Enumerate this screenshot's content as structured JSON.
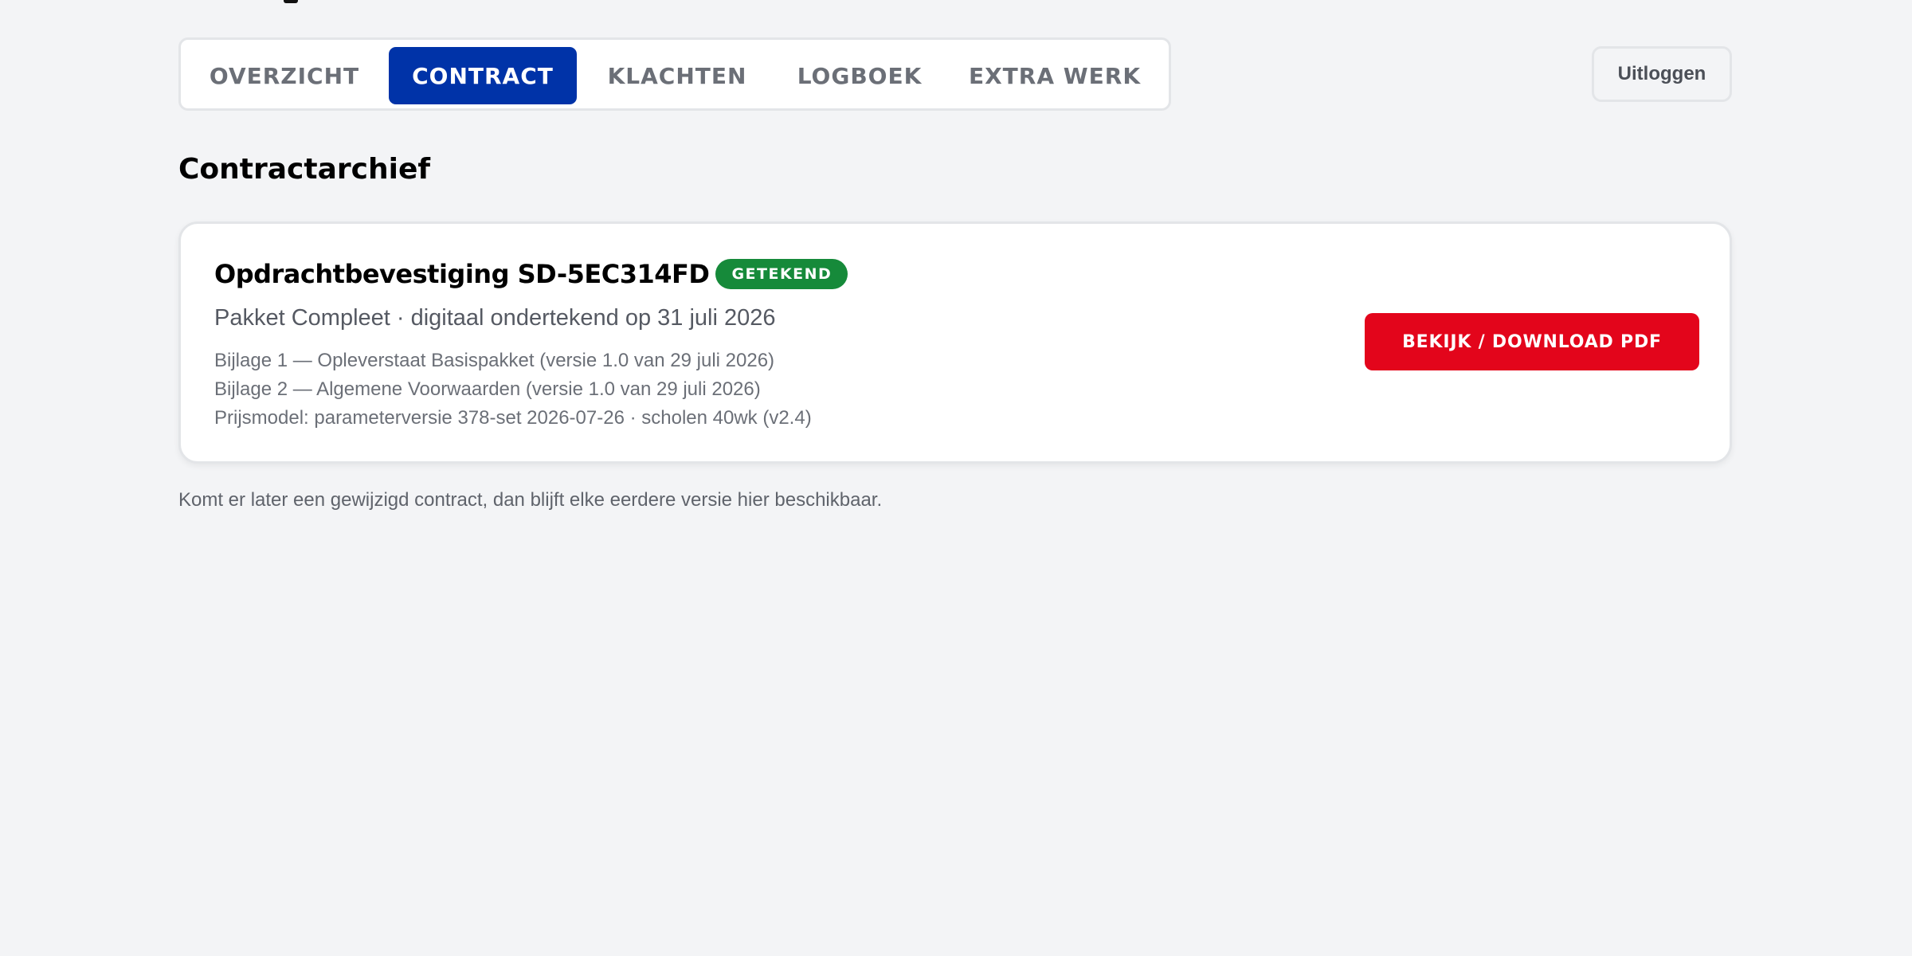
{
  "tabs": [
    {
      "label": "OVERZICHT",
      "active": false
    },
    {
      "label": "CONTRACT",
      "active": true
    },
    {
      "label": "KLACHTEN",
      "active": false
    },
    {
      "label": "LOGBOEK",
      "active": false
    },
    {
      "label": "EXTRA WERK",
      "active": false
    }
  ],
  "header": {
    "logout_label": "Uitloggen"
  },
  "main": {
    "title": "Contractarchief",
    "contract": {
      "title": "Opdrachtbevestiging SD-5EC314FD",
      "status": "GETEKEND",
      "subtitle": "Pakket Compleet · digitaal ondertekend op 31 juli 2026",
      "details": [
        "Bijlage 1 — Opleverstaat Basispakket (versie 1.0 van 29 juli 2026)",
        "Bijlage 2 — Algemene Voorwaarden (versie 1.0 van 29 juli 2026)",
        "Prijsmodel: parameterversie 378-set 2026-07-26 · scholen 40wk (v2.4)"
      ],
      "download_label": "BEKIJK / DOWNLOAD PDF"
    },
    "footnote": "Komt er later een gewijzigd contract, dan blijft elke eerdere versie hier beschikbaar."
  },
  "colors": {
    "background": "#f3f4f6",
    "tab_active": "#0033a8",
    "status_badge": "#168a3a",
    "primary_action": "#e3051b"
  }
}
